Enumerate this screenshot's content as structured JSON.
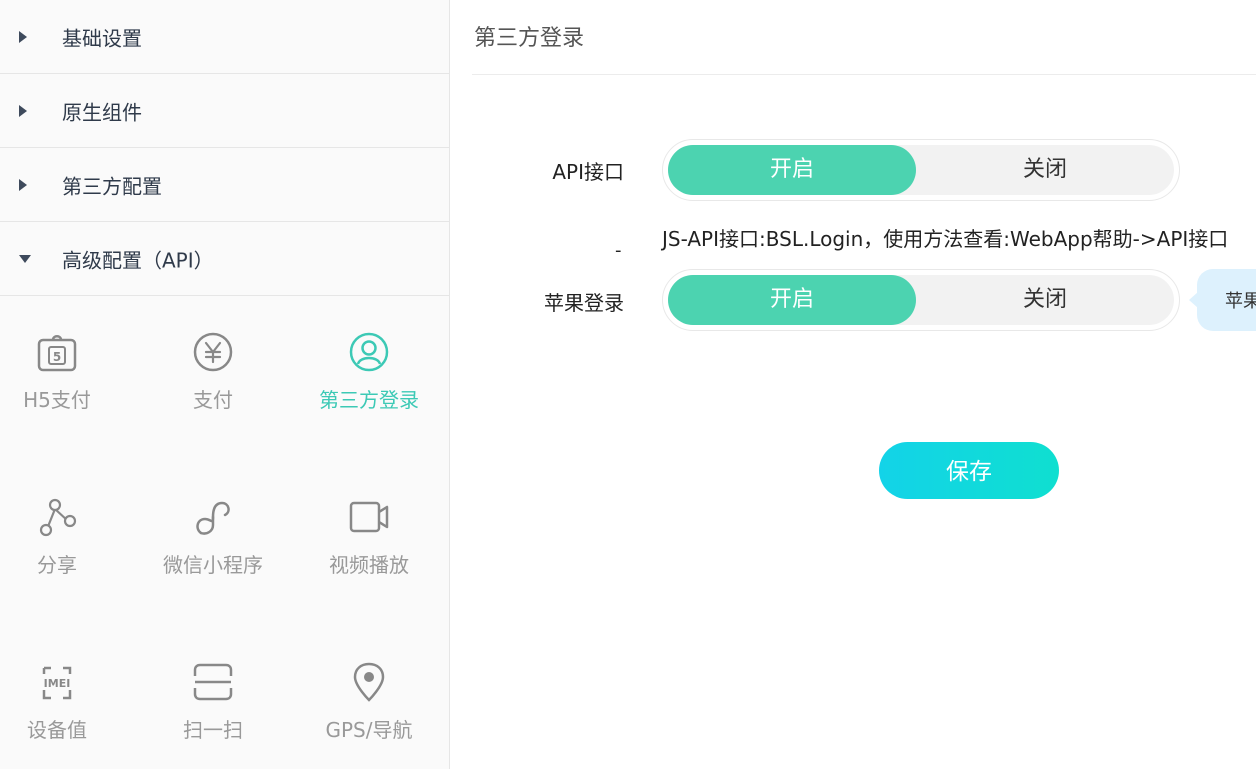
{
  "sidebar": {
    "sections": [
      {
        "label": "基础设置",
        "expanded": false
      },
      {
        "label": "原生组件",
        "expanded": false
      },
      {
        "label": "第三方配置",
        "expanded": false
      },
      {
        "label": "高级配置（API）",
        "expanded": true
      }
    ],
    "tiles": [
      {
        "label": "H5支付",
        "icon": "h5-pay-icon",
        "active": false
      },
      {
        "label": "支付",
        "icon": "yen-coin-icon",
        "active": false
      },
      {
        "label": "第三方登录",
        "icon": "user-circle-icon",
        "active": true
      },
      {
        "label": "分享",
        "icon": "share-nodes-icon",
        "active": false
      },
      {
        "label": "微信小程序",
        "icon": "mini-program-icon",
        "active": false
      },
      {
        "label": "视频播放",
        "icon": "video-camera-icon",
        "active": false
      },
      {
        "label": "设备值",
        "icon": "imei-icon",
        "active": false
      },
      {
        "label": "扫一扫",
        "icon": "scan-icon",
        "active": false
      },
      {
        "label": "GPS/导航",
        "icon": "location-pin-icon",
        "active": false
      }
    ],
    "active_color": "#3cc9b5"
  },
  "main": {
    "title": "第三方登录",
    "rows": [
      {
        "label": "API接口",
        "on_label": "开启",
        "off_label": "关闭",
        "selected": "开启"
      },
      {
        "label": "苹果登录",
        "on_label": "开启",
        "off_label": "关闭",
        "selected": "开启"
      }
    ],
    "hint_text": "JS-API接口:BSL.Login，使用方法查看:WebApp帮助->API接口",
    "dash": "-",
    "tooltip_text": "苹果",
    "save_label": "保存",
    "accent": "#4cd3b0"
  }
}
